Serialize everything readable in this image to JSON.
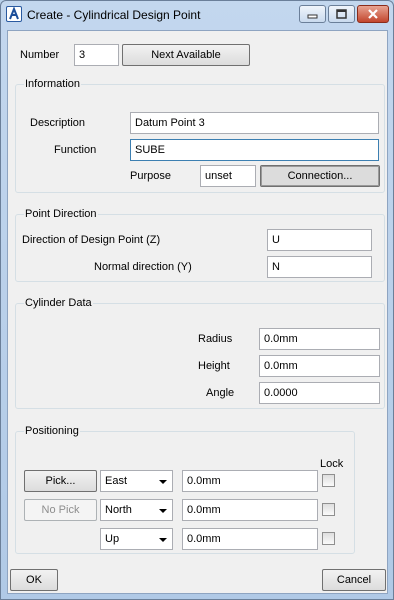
{
  "window": {
    "title": "Create - Cylindrical Design Point"
  },
  "number": {
    "label": "Number",
    "value": "3",
    "next_available_label": "Next Available"
  },
  "information": {
    "title": "Information",
    "description_label": "Description",
    "description_value": "Datum Point 3",
    "function_label": "Function",
    "function_value": "SUBE",
    "purpose_label": "Purpose",
    "purpose_value": "unset",
    "connection_label": "Connection..."
  },
  "point_direction": {
    "title": "Point Direction",
    "direction_label": "Direction of Design Point (Z)",
    "direction_value": "U",
    "normal_label": "Normal direction (Y)",
    "normal_value": "N"
  },
  "cylinder_data": {
    "title": "Cylinder Data",
    "radius_label": "Radius",
    "radius_value": "0.0mm",
    "height_label": "Height",
    "height_value": "0.0mm",
    "angle_label": "Angle",
    "angle_value": "0.0000"
  },
  "positioning": {
    "title": "Positioning",
    "lock_label": "Lock",
    "rows": [
      {
        "button": "Pick...",
        "button_enabled": true,
        "direction": "East",
        "value": "0.0mm",
        "locked": false
      },
      {
        "button": "No Pick",
        "button_enabled": false,
        "direction": "North",
        "value": "0.0mm",
        "locked": false
      },
      {
        "button": "",
        "button_enabled": false,
        "direction": "Up",
        "value": "0.0mm",
        "locked": false
      }
    ]
  },
  "footer": {
    "ok_label": "OK",
    "cancel_label": "Cancel"
  }
}
